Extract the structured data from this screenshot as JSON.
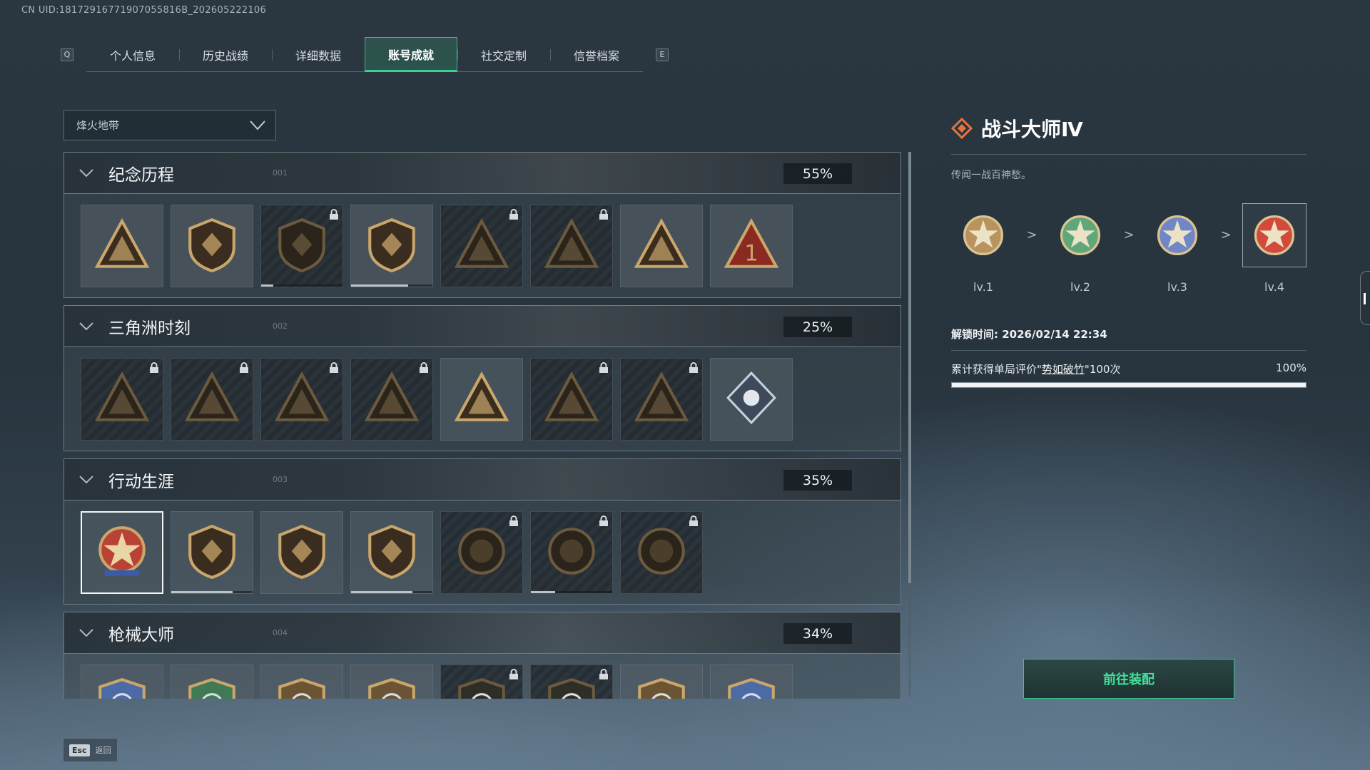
{
  "uid": "CN UID:18172916771907055816B_202605222106",
  "tabbar": {
    "left_key": "Q",
    "right_key": "E",
    "tabs": [
      {
        "label": "个人信息",
        "active": false
      },
      {
        "label": "历史战绩",
        "active": false
      },
      {
        "label": "详细数据",
        "active": false
      },
      {
        "label": "账号成就",
        "active": true
      },
      {
        "label": "社交定制",
        "active": false
      },
      {
        "label": "信誉档案",
        "active": false
      }
    ]
  },
  "mode_select": {
    "value": "烽火地带"
  },
  "sections": [
    {
      "title": "纪念历程",
      "index": "001",
      "percent": "55%"
    },
    {
      "title": "三角洲时刻",
      "index": "002",
      "percent": "25%"
    },
    {
      "title": "行动生涯",
      "index": "003",
      "percent": "35%"
    },
    {
      "title": "枪械大师",
      "index": "004",
      "percent": "34%"
    }
  ],
  "badge_icons": {
    "s0": [
      "triangle-emblem-icon",
      "helicopter-emblem-icon",
      "hex-shield-icon",
      "winged-sb-icon",
      "masked-triangle-icon",
      "soldier-triangle-icon",
      "wings-triangle-icon",
      "number-one-triangle-icon"
    ],
    "s1": [
      "supply-triangle-icon",
      "medic-triangle-icon",
      "runner-triangle-icon",
      "wreath-triangle-icon",
      "squad-triangle-icon",
      "bear-triangle-icon",
      "wolf-triangle-icon",
      "rose-diamond-icon"
    ],
    "s2": [
      "star-medal-icon",
      "spade-shield-icon",
      "winged-shield-icon",
      "diamond-shield-icon",
      "helmet-coin-icon",
      "skull-coin-icon",
      "eye-coin-icon"
    ],
    "s3": [
      "blue-gun-shield-icon",
      "green-gun-shield-icon",
      "bronze-gun-shield-icon",
      "bronze-gun-shield-icon",
      "dark-gun-shield-icon",
      "dark-gun-shield-icon",
      "bronze-gun-shield-icon",
      "blue-gun-shield-icon"
    ]
  },
  "badge_states": {
    "s0_locked": [
      false,
      false,
      true,
      false,
      true,
      true,
      false,
      false
    ],
    "s1_locked": [
      true,
      true,
      true,
      true,
      false,
      true,
      true,
      false
    ],
    "s2_locked": [
      false,
      false,
      false,
      false,
      true,
      true,
      true
    ],
    "s3_locked": [
      false,
      false,
      false,
      false,
      true,
      true,
      false,
      false
    ],
    "s0_progress": [
      0,
      0,
      0.15,
      0.7,
      0,
      0,
      0,
      0
    ],
    "s2_progress": [
      0,
      0.75,
      0,
      0.75,
      0,
      0.3,
      0
    ]
  },
  "detail": {
    "title": "战斗大师Ⅳ",
    "description": "传闻一战百神愁。",
    "levels": [
      {
        "label": "lv.1",
        "color": "#b8935e"
      },
      {
        "label": "lv.2",
        "color": "#5fa77b"
      },
      {
        "label": "lv.3",
        "color": "#6f86c7"
      },
      {
        "label": "lv.4",
        "color": "#d24a3c"
      }
    ],
    "separator": ">",
    "unlock_time": "解锁时间: 2026/02/14 22:34",
    "condition_prefix": "累计获得单局评价\"",
    "condition_keyword": "势如破竹",
    "condition_suffix": "\"100次",
    "condition_percent": "100%",
    "condition_progress": 1.0
  },
  "equip_button": "前往装配",
  "esc": {
    "key": "Esc",
    "label": "返回"
  },
  "colors": {
    "accent": "#3ad08d",
    "gold": "#c9a66b",
    "title_icon": "#e8743b"
  }
}
